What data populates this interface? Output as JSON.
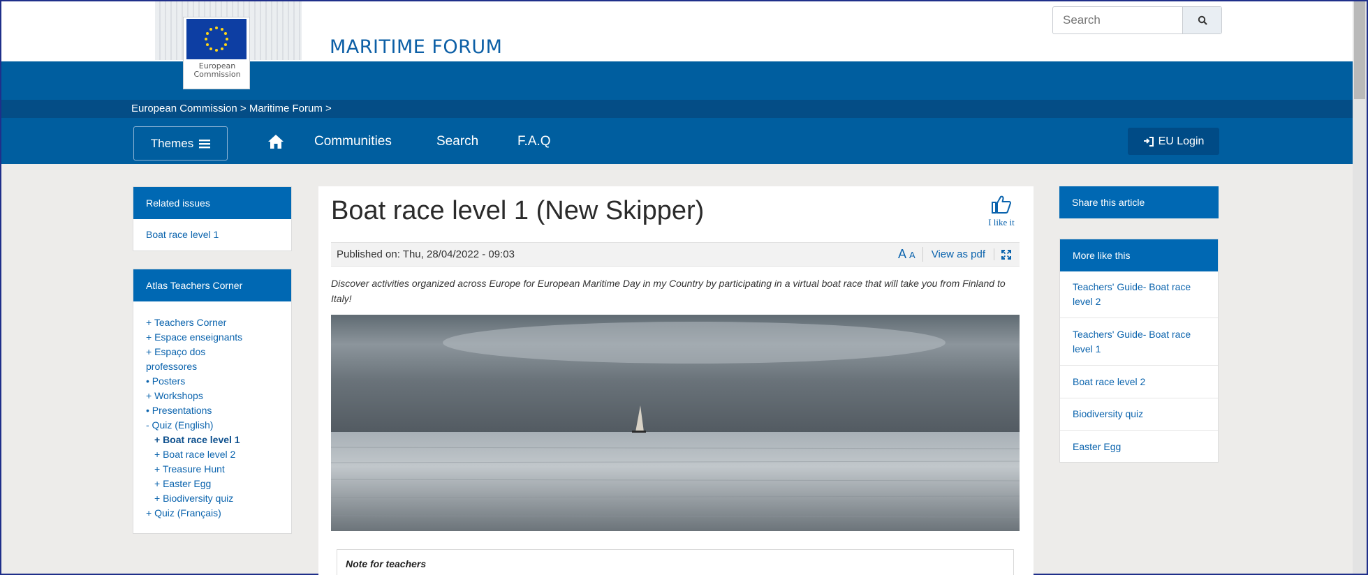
{
  "header": {
    "logo_text_line1": "European",
    "logo_text_line2": "Commission",
    "site_title": "MARITIME FORUM",
    "search_placeholder": "Search"
  },
  "breadcrumb": "European Commission > Maritime Forum >",
  "nav": {
    "themes_label": "Themes",
    "links": [
      "Communities",
      "Search",
      "F.A.Q"
    ],
    "login_label": "EU Login"
  },
  "left": {
    "related_title": "Related issues",
    "related_link": "Boat race level 1",
    "atlas_title": "Atlas Teachers Corner",
    "tree": [
      "+ Teachers Corner",
      "+ Espace enseignants",
      "+ Espaço dos",
      "professores",
      "• Posters",
      "+ Workshops",
      "• Presentations",
      "- Quiz (English)",
      "+ Boat race level 1",
      "+ Boat race level 2",
      "+ Treasure Hunt",
      "+ Easter Egg",
      "+ Biodiversity quiz",
      "+ Quiz (Français)"
    ]
  },
  "article": {
    "title": "Boat race level 1 (New Skipper)",
    "like_label": "I like it",
    "published": "Published on: Thu, 28/04/2022 - 09:03",
    "font_size_label_big": "A",
    "font_size_label_small": "A",
    "view_pdf": "View as pdf",
    "intro": "Discover activities organized across Europe for European Maritime Day in my Country by participating in a virtual boat race that will take you from Finland to Italy!",
    "note_title": "Note for teachers"
  },
  "right": {
    "share_title": "Share this article",
    "more_title": "More like this",
    "more_items": [
      "Teachers' Guide- Boat race level 2",
      "Teachers' Guide- Boat race level 1",
      "Boat race level 2",
      "Biodiversity quiz",
      "Easter Egg"
    ]
  },
  "colors": {
    "primary_blue": "#005e9f",
    "crumb_blue": "#044d86",
    "panel_head_blue": "#0068b3",
    "link_blue": "#0a63ad",
    "page_bg": "#edecea"
  }
}
